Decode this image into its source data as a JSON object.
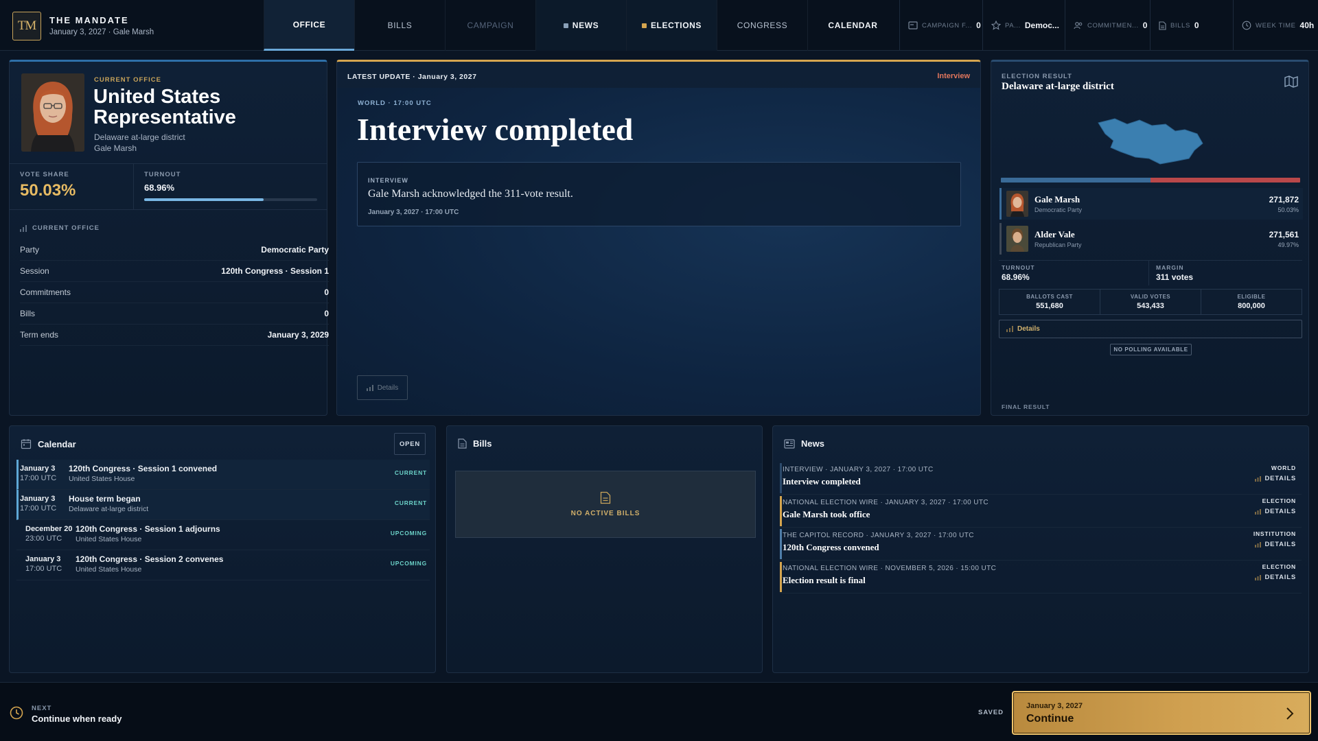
{
  "app": {
    "logo": "TM",
    "title": "THE MANDATE",
    "subtitle": "January 3, 2027 · Gale Marsh"
  },
  "tabs": [
    {
      "label": "OFFICE",
      "state": "active"
    },
    {
      "label": "BILLS",
      "state": "normal"
    },
    {
      "label": "CAMPAIGN",
      "state": "disabled"
    },
    {
      "label": "NEWS",
      "state": "dark",
      "dot_color": "#8aa0b8"
    },
    {
      "label": "ELECTIONS",
      "state": "dark",
      "dot_color": "#d5a54f"
    },
    {
      "label": "CONGRESS",
      "state": "normal"
    },
    {
      "label": "CALENDAR",
      "state": "bold"
    }
  ],
  "stats": [
    {
      "icon": "campaign-funds-icon",
      "label": "CAMPAIGN F...",
      "value": "0"
    },
    {
      "icon": "star-icon",
      "label": "PA...",
      "value": "Democ..."
    },
    {
      "icon": "people-icon",
      "label": "COMMITMEN...",
      "value": "0"
    },
    {
      "icon": "document-icon",
      "label": "BILLS",
      "value": "0"
    },
    {
      "icon": "clock-icon",
      "label": "WEEK TIME",
      "value": "40h"
    }
  ],
  "office": {
    "caption": "CURRENT OFFICE",
    "title": "United States Representative",
    "district": "Delaware at-large district",
    "name": "Gale Marsh",
    "vote_share_label": "VOTE SHARE",
    "vote_share": "50.03%",
    "turnout_label": "TURNOUT",
    "turnout": "68.96%",
    "turnout_fraction": 0.6896,
    "section_label": "CURRENT OFFICE",
    "rows": [
      {
        "k": "Party",
        "v": "Democratic Party"
      },
      {
        "k": "Session",
        "v": "120th Congress · Session 1"
      },
      {
        "k": "Commitments",
        "v": "0"
      },
      {
        "k": "Bills",
        "v": "0"
      },
      {
        "k": "Term ends",
        "v": "January 3, 2029"
      }
    ]
  },
  "latest": {
    "header": "LATEST UPDATE · January 3, 2027",
    "tag": "Interview",
    "meta": "WORLD · 17:00 UTC",
    "title": "Interview completed",
    "card_caption": "INTERVIEW",
    "card_text": "Gale Marsh acknowledged the 311-vote result.",
    "card_time": "January 3, 2027 · 17:00 UTC",
    "details": "Details"
  },
  "election": {
    "caption": "ELECTION RESULT",
    "title": "Delaware at-large district",
    "dem_color": "#3a6b98",
    "rep_color": "#b9484a",
    "dem_share": 0.5003,
    "candidates": [
      {
        "name": "Gale Marsh",
        "party": "Democratic Party",
        "votes": "271,872",
        "pct": "50.03%",
        "color": "#3a6b98"
      },
      {
        "name": "Alder Vale",
        "party": "Republican Party",
        "votes": "271,561",
        "pct": "49.97%",
        "color": "#8a8f96"
      }
    ],
    "turnout_label": "TURNOUT",
    "turnout": "68.96%",
    "margin_label": "MARGIN",
    "margin": "311 votes",
    "grid": [
      {
        "label": "BALLOTS CAST",
        "value": "551,680"
      },
      {
        "label": "VALID VOTES",
        "value": "543,433"
      },
      {
        "label": "ELIGIBLE",
        "value": "800,000"
      }
    ],
    "details": "Details",
    "no_polling": "NO POLLING AVAILABLE",
    "final": "FINAL RESULT"
  },
  "calendar": {
    "title": "Calendar",
    "open": "OPEN",
    "items": [
      {
        "date": "January 3",
        "time": "17:00 UTC",
        "title": "120th Congress · Session 1 convened",
        "sub": "United States House",
        "badge": "CURRENT"
      },
      {
        "date": "January 3",
        "time": "17:00 UTC",
        "title": "House term began",
        "sub": "Delaware at-large district",
        "badge": "CURRENT"
      },
      {
        "date": "December 20",
        "time": "23:00 UTC",
        "title": "120th Congress · Session 1 adjourns",
        "sub": "United States House",
        "badge": "UPCOMING"
      },
      {
        "date": "January 3",
        "time": "17:00 UTC",
        "title": "120th Congress · Session 2 convenes",
        "sub": "United States House",
        "badge": "UPCOMING"
      }
    ]
  },
  "bills": {
    "title": "Bills",
    "empty": "NO ACTIVE BILLS"
  },
  "news": {
    "title": "News",
    "items": [
      {
        "meta": "INTERVIEW · JANUARY 3, 2027 · 17:00 UTC",
        "title": "Interview completed",
        "cat": "WORLD",
        "details": "DETAILS",
        "bar": "#2c4a6b"
      },
      {
        "meta": "NATIONAL ELECTION WIRE · JANUARY 3, 2027 · 17:00 UTC",
        "title": "Gale Marsh took office",
        "cat": "ELECTION",
        "details": "DETAILS",
        "bar": "#d5a54f"
      },
      {
        "meta": "THE CAPITOL RECORD · JANUARY 3, 2027 · 17:00 UTC",
        "title": "120th Congress convened",
        "cat": "INSTITUTION",
        "details": "DETAILS",
        "bar": "#4f7eaa"
      },
      {
        "meta": "NATIONAL ELECTION WIRE · NOVEMBER 5, 2026 · 15:00 UTC",
        "title": "Election result is final",
        "cat": "ELECTION",
        "details": "DETAILS",
        "bar": "#d5a54f"
      }
    ]
  },
  "footer": {
    "next_label": "NEXT",
    "next_text": "Continue when ready",
    "saved": "SAVED",
    "continue_date": "January 3, 2027",
    "continue_label": "Continue"
  }
}
